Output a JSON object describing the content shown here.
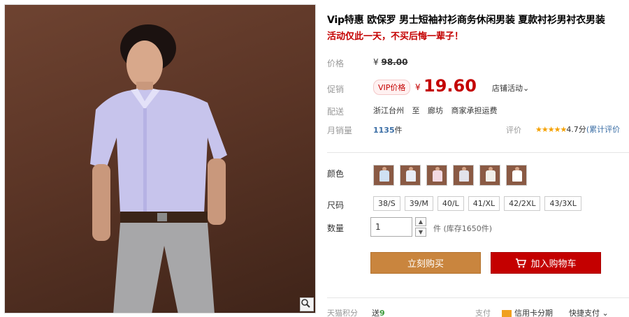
{
  "product": {
    "title": "Vip特惠 欧保罗 男士短袖衬衫商务休闲男装 夏款衬衫男衬衣男装",
    "subtitle": "活动仅此一天，不买后悔一辈子！"
  },
  "price": {
    "label": "价格",
    "currency": "¥",
    "original": "98.00",
    "promo_label": "促销",
    "vip_badge": "VIP价格",
    "current": "19.60",
    "store_activity": "店铺活动"
  },
  "shipping": {
    "label": "配送",
    "from": "浙江台州",
    "to_word": "至",
    "to": "廊坊",
    "fee": "商家承担运费"
  },
  "sales": {
    "label": "月销量",
    "count": "1135",
    "unit": "件",
    "rating_label": "评价",
    "stars": "★★★★★",
    "score": "4.7分",
    "reviews": "(累计评价"
  },
  "sku": {
    "color_label": "颜色",
    "colors": [
      {
        "shirt": "#cfe0f2"
      },
      {
        "shirt": "#e8ecf6"
      },
      {
        "shirt": "#f2d9e2"
      },
      {
        "shirt": "#e2e2ea"
      },
      {
        "shirt": "#f0efe9"
      },
      {
        "shirt": "#ffffff"
      }
    ],
    "size_label": "尺码",
    "sizes": [
      "38/S",
      "39/M",
      "40/L",
      "41/XL",
      "42/2XL",
      "43/3XL"
    ],
    "qty_label": "数量",
    "qty_value": "1",
    "stock_text": "件 (库存1650件)"
  },
  "actions": {
    "buy_now": "立刻购买",
    "add_to_cart": "加入购物车"
  },
  "footer": {
    "points_label": "天猫积分",
    "points_prefix": "送",
    "points_value": "9",
    "pay_label": "支付",
    "credit": "信用卡分期",
    "quick_pay": "快捷支付"
  },
  "colors": {
    "accent_red": "#c40000",
    "buy_orange": "#c9853e",
    "star": "#f5a100",
    "link_blue": "#3c6fa6"
  }
}
